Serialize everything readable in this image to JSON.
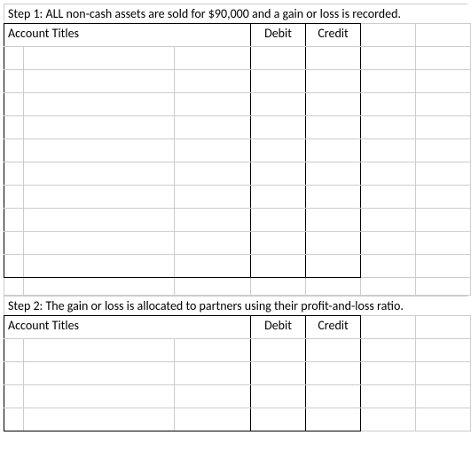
{
  "step1": {
    "title": "Step 1: ALL non-cash assets are sold for $90,000 and a gain or loss is recorded.",
    "headers": {
      "account": "Account Titles",
      "debit": "Debit",
      "credit": "Credit"
    }
  },
  "step2": {
    "title": "Step 2: The gain or loss is allocated to partners using their profit-and-loss ratio.",
    "headers": {
      "account": "Account Titles",
      "debit": "Debit",
      "credit": "Credit"
    }
  }
}
